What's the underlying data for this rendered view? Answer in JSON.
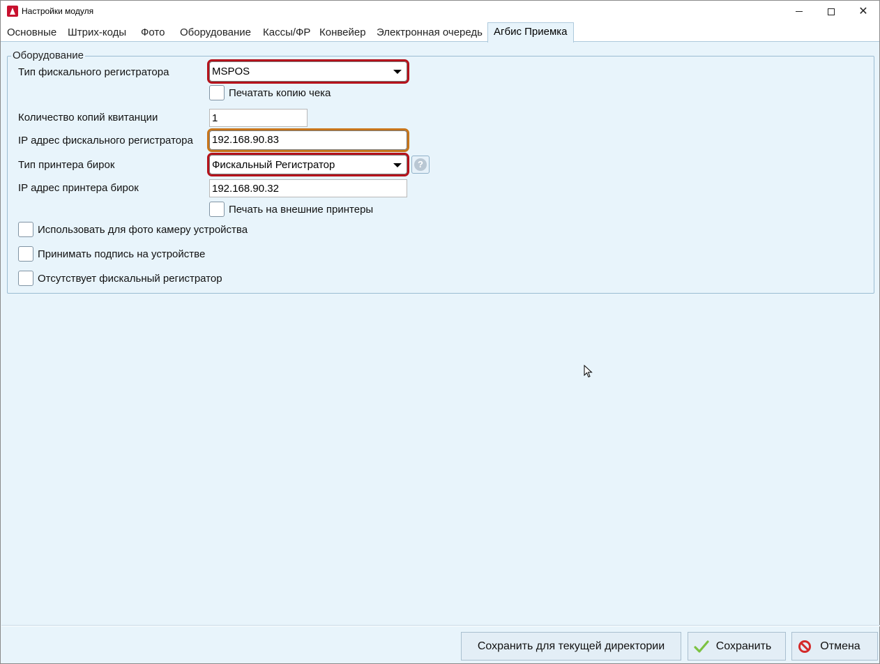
{
  "window": {
    "title": "Настройки модуля"
  },
  "tabs": [
    {
      "label": "Основные"
    },
    {
      "label": "Штрих-коды"
    },
    {
      "label": "Фото"
    },
    {
      "label": "Оборудование"
    },
    {
      "label": "Кассы/ФР"
    },
    {
      "label": "Конвейер"
    },
    {
      "label": "Электронная очередь"
    },
    {
      "label": "Агбис Приемка",
      "active": true
    }
  ],
  "equipment": {
    "legend": "Оборудование",
    "fiscal_type_label": "Тип фискального регистратора",
    "fiscal_type_value": "MSPOS",
    "print_receipt_copy_label": "Печатать копию чека",
    "copies_label": "Количество копий квитанции",
    "copies_value": "1",
    "fiscal_ip_label": "IP адрес фискального регистратора",
    "fiscal_ip_value": "192.168.90.83",
    "tag_printer_type_label": "Тип принтера бирок",
    "tag_printer_type_value": "Фискальный Регистратор",
    "tag_printer_ip_label": "IP адрес принтера бирок",
    "tag_printer_ip_value": "192.168.90.32",
    "external_printers_label": "Печать на внешние принтеры",
    "use_camera_label": "Использовать для фото камеру устройства",
    "accept_signature_label": "Принимать подпись на устройстве",
    "no_fiscal_label": "Отсутствует фискальный регистратор"
  },
  "footer": {
    "save_dir_label": "Сохранить для текущей директории",
    "save_label": "Сохранить",
    "cancel_label": "Отмена"
  },
  "colors": {
    "highlight_red": "#b5121b",
    "highlight_orange": "#c8751a",
    "panel_bg": "#e8f4fb"
  }
}
